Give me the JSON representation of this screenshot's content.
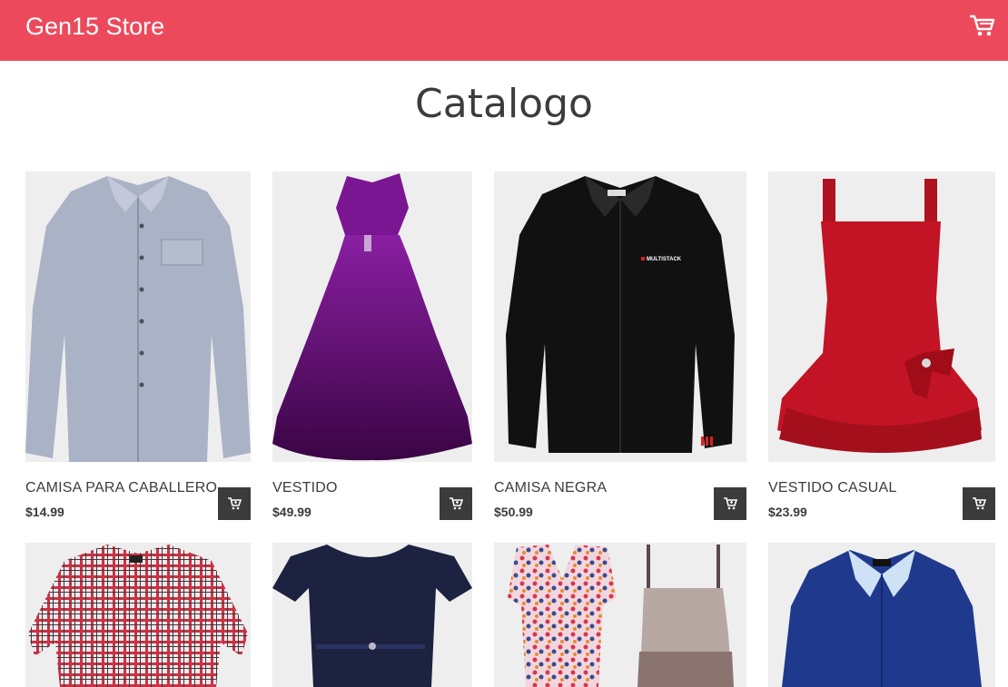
{
  "header": {
    "brand": "Gen15 Store",
    "cart_icon": "cart-icon",
    "background_color": "#ec4a5c"
  },
  "catalog": {
    "title": "Catalogo",
    "products": [
      {
        "name": "CAMISA PARA CABALLERO",
        "price": "$14.99",
        "image": "gray-shirt"
      },
      {
        "name": "VESTIDO",
        "price": "$49.99",
        "image": "purple-gown"
      },
      {
        "name": "CAMISA NEGRA",
        "price": "$50.99",
        "image": "black-shirt",
        "logo_text": "MULTISTACK"
      },
      {
        "name": "VESTIDO CASUAL",
        "price": "$23.99",
        "image": "red-dress"
      },
      {
        "image": "red-plaid-shirt"
      },
      {
        "image": "navy-dress"
      },
      {
        "image": "floral-dress-and-blouse"
      },
      {
        "image": "blue-shirt"
      }
    ],
    "add_button_icon": "add-to-cart-icon",
    "button_color": "#3b3b3b"
  }
}
